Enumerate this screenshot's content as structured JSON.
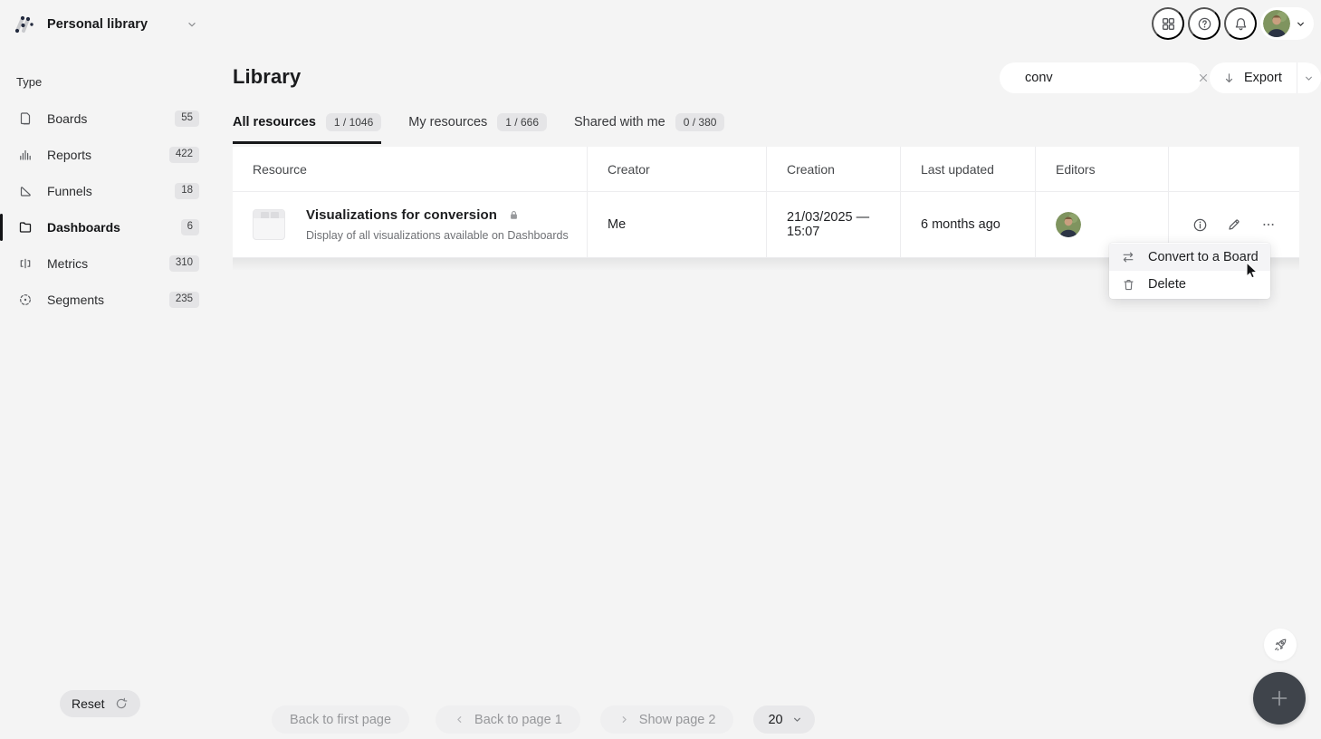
{
  "colors": {
    "page_bg": "#f4f4f4",
    "surface": "#ffffff",
    "text_primary": "#1f2023",
    "text_secondary": "#6e7074",
    "badge_bg": "#e5e5e7",
    "active_underline": "#17181a",
    "fab_bg": "#3f444b"
  },
  "topbar": {
    "workspace_name": "Personal library",
    "icons": [
      "apps-grid-icon",
      "help-icon",
      "notifications-bell-icon",
      "user-avatar",
      "chevron-down-icon"
    ]
  },
  "sidebar": {
    "section_label": "Type",
    "items": [
      {
        "label": "Boards",
        "count": "55",
        "icon": "file-icon",
        "active": false
      },
      {
        "label": "Reports",
        "count": "422",
        "icon": "bar-chart-icon",
        "active": false
      },
      {
        "label": "Funnels",
        "count": "18",
        "icon": "funnel-icon",
        "active": false
      },
      {
        "label": "Dashboards",
        "count": "6",
        "icon": "folder-icon",
        "active": true
      },
      {
        "label": "Metrics",
        "count": "310",
        "icon": "metric-icon",
        "active": false
      },
      {
        "label": "Segments",
        "count": "235",
        "icon": "segment-icon",
        "active": false
      }
    ],
    "reset_label": "Reset",
    "reset_icon": "reload-icon"
  },
  "header": {
    "page_title": "Library",
    "search": {
      "value": "conv",
      "clear_icon": "x-icon"
    },
    "export": {
      "label": "Export",
      "icon": "download-arrow-icon",
      "caret_icon": "chevron-down-icon"
    }
  },
  "tabs": [
    {
      "label": "All resources",
      "badge": "1 / 1046",
      "active": true
    },
    {
      "label": "My resources",
      "badge": "1 / 666",
      "active": false
    },
    {
      "label": "Shared with me",
      "badge": "0 / 380",
      "active": false
    }
  ],
  "table": {
    "columns": [
      "Resource",
      "Creator",
      "Creation",
      "Last updated",
      "Editors"
    ],
    "rows": [
      {
        "title": "Visualizations for conversion",
        "private": true,
        "private_icon": "lock-icon",
        "description": "Display of all visualizations available on Dashboards",
        "creator": "Me",
        "creation": "21/03/2025 — 15:07",
        "last_updated": "6 months ago",
        "editors": [
          "user-avatar"
        ],
        "actions": [
          "info-icon",
          "edit-pencil-icon",
          "more-ellipsis-icon"
        ]
      }
    ]
  },
  "context_menu": {
    "items": [
      {
        "icon": "swap-arrows-icon",
        "label": "Convert to a Board",
        "hovered": true
      },
      {
        "icon": "trash-icon",
        "label": "Delete",
        "hovered": false
      }
    ]
  },
  "pagination": {
    "back_to_first_label": "Back to first page",
    "back_to_prev_label": "Back to page 1",
    "next_label": "Show page 2",
    "page_size": "20"
  },
  "floating": {
    "icons": [
      "rocket-icon",
      "plus-icon"
    ]
  }
}
